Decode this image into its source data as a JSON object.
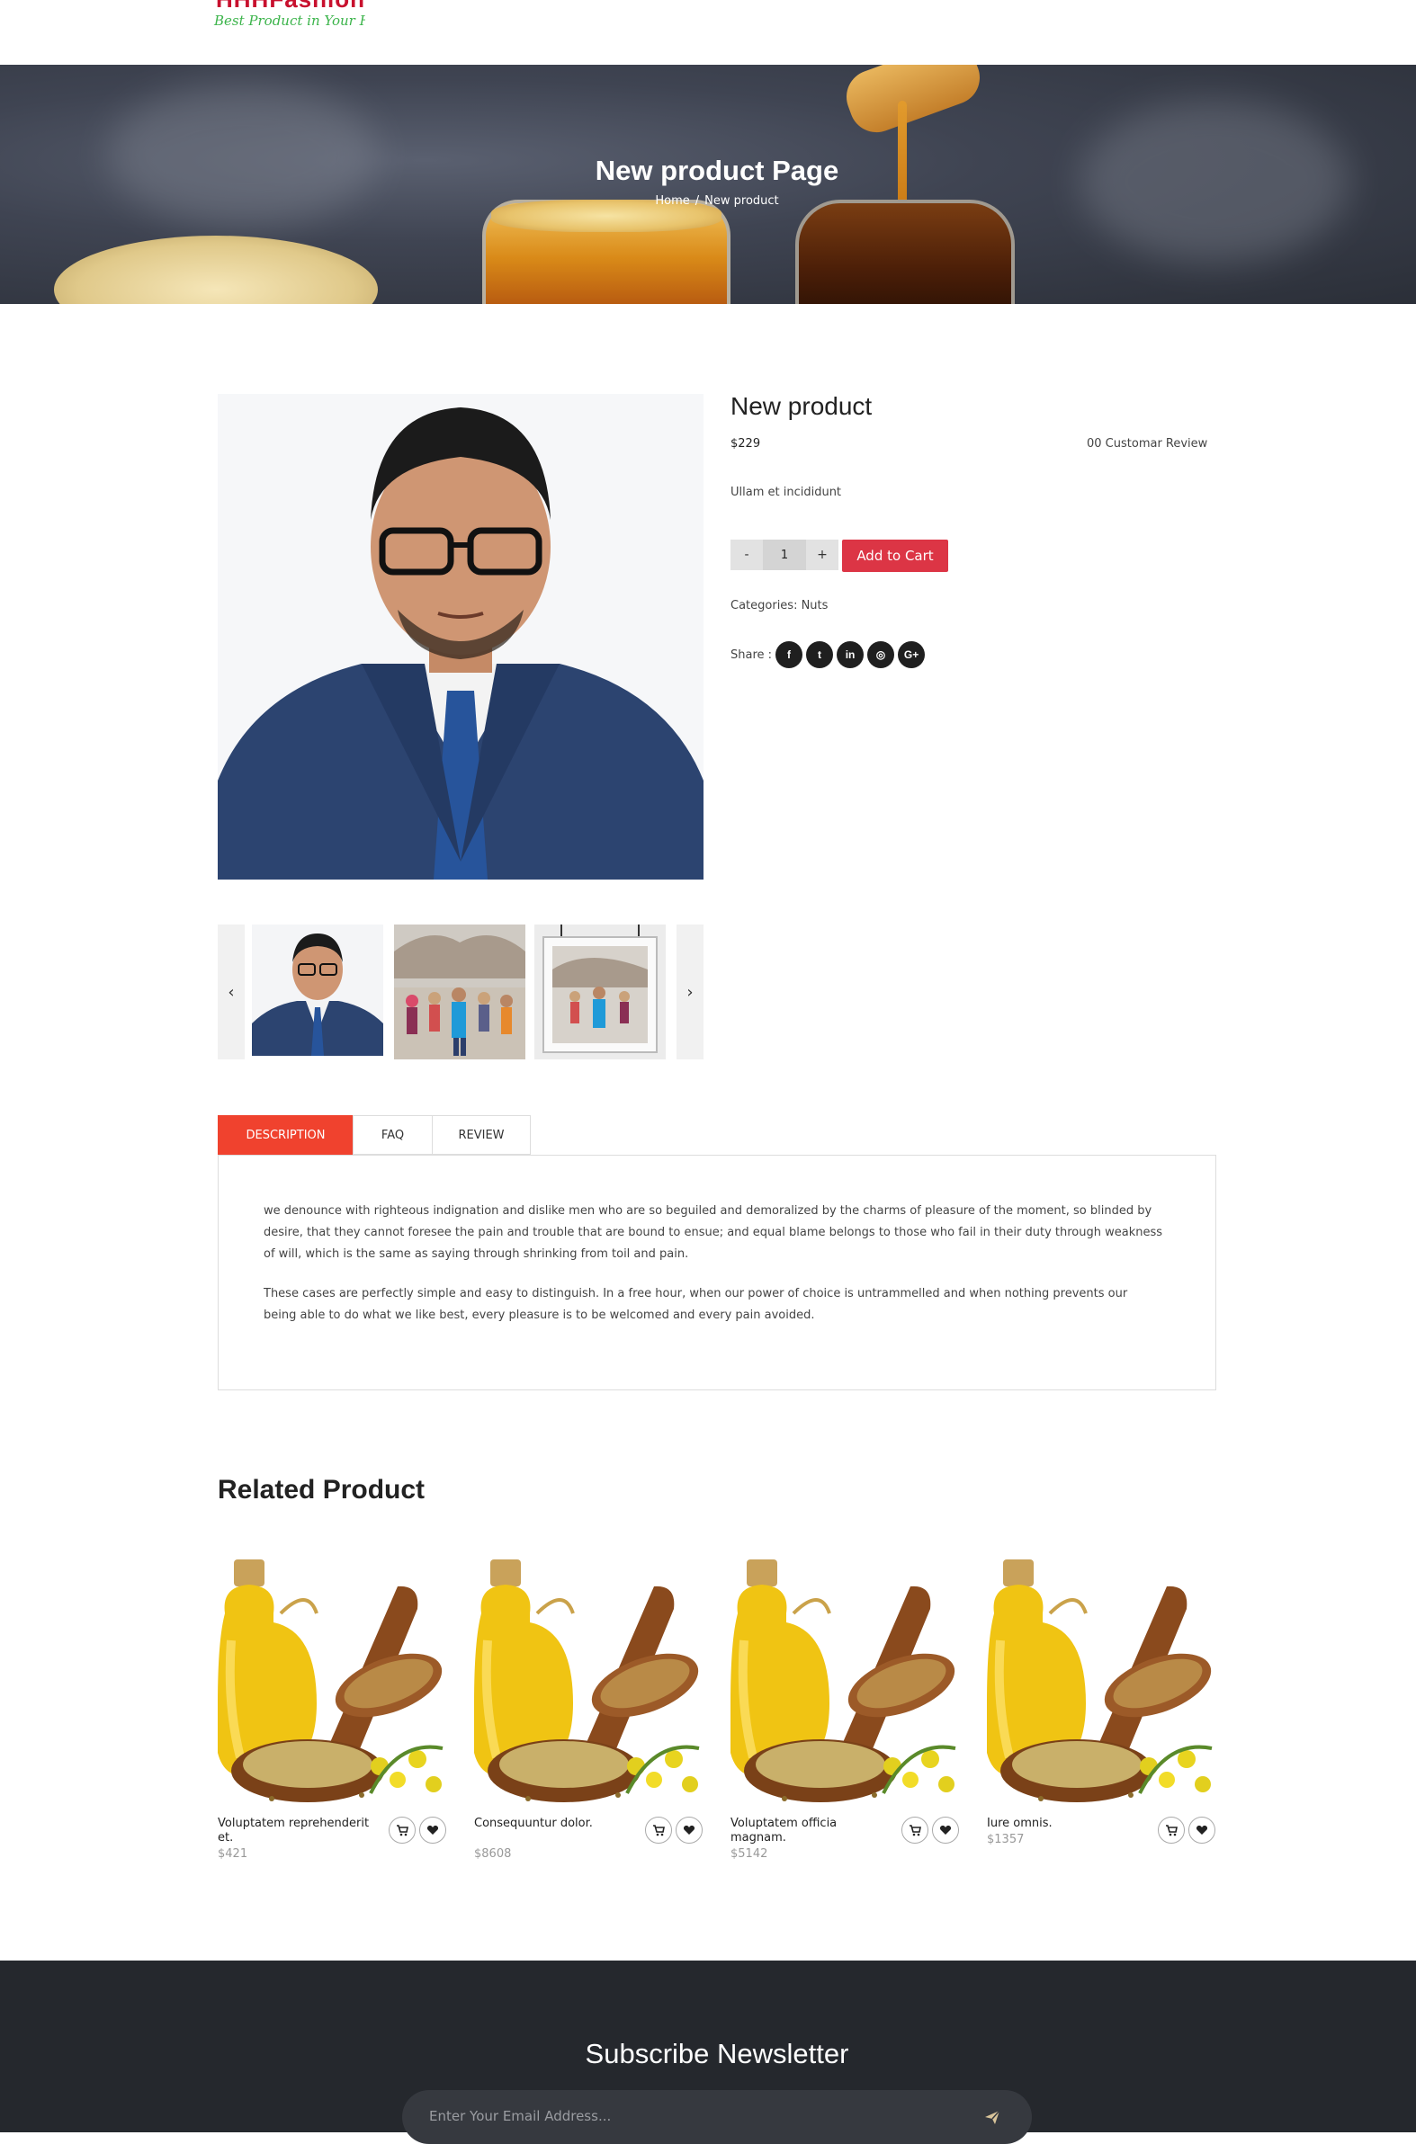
{
  "header": {
    "logo_text": "HHHFashion",
    "logo_tagline": "Best Product in Your Hand"
  },
  "hero": {
    "title": "New product Page",
    "breadcrumb_home": "Home",
    "breadcrumb_sep": "/",
    "breadcrumb_current": "New product"
  },
  "product": {
    "title": "New product",
    "price": "$229",
    "review": "00 Customar Review",
    "short_desc": "Ullam et incididunt",
    "qty_minus": "-",
    "qty_value": "1",
    "qty_plus": "+",
    "add_to_cart": "Add to Cart",
    "categories": "Categories: Nuts",
    "share_label": "Share :",
    "share_icons": [
      {
        "icon": "facebook-icon",
        "glyph": "f"
      },
      {
        "icon": "twitter-icon",
        "glyph": "t"
      },
      {
        "icon": "linkedin-icon",
        "glyph": "in"
      },
      {
        "icon": "instagram-icon",
        "glyph": "◎"
      },
      {
        "icon": "google-plus-icon",
        "glyph": "G+"
      }
    ],
    "thumb_prev": "‹",
    "thumb_next": "›"
  },
  "tabs": {
    "items": [
      "DESCRIPTION",
      "FAQ",
      "REVIEW"
    ],
    "active": "DESCRIPTION",
    "description_p1": "we denounce with righteous indignation and dislike men who are so beguiled and demoralized by the charms of pleasure of the moment, so blinded by desire, that they cannot foresee the pain and trouble that are bound to ensue; and equal blame belongs to those who fail in their duty through weakness of will, which is the same as saying through shrinking from toil and pain.",
    "description_p2": "These cases are perfectly simple and easy to distinguish. In a free hour, when our power of choice is untrammelled and when nothing prevents our being able to do what we like best, every pleasure is to be welcomed and every pain avoided."
  },
  "related": {
    "title": "Related Product",
    "products": [
      {
        "name": "Voluptatem reprehenderit et.",
        "price": "$421"
      },
      {
        "name": "Consequuntur dolor.",
        "price": "$8608"
      },
      {
        "name": "Voluptatem officia magnam.",
        "price": "$5142"
      },
      {
        "name": "Iure omnis.",
        "price": "$1357"
      }
    ]
  },
  "newsletter": {
    "title": "Subscribe Newsletter",
    "placeholder": "Enter Your Email Address..."
  },
  "colors": {
    "accent_red": "#dc3545",
    "tab_active": "#f0422e",
    "footer_bg": "#25282d"
  }
}
